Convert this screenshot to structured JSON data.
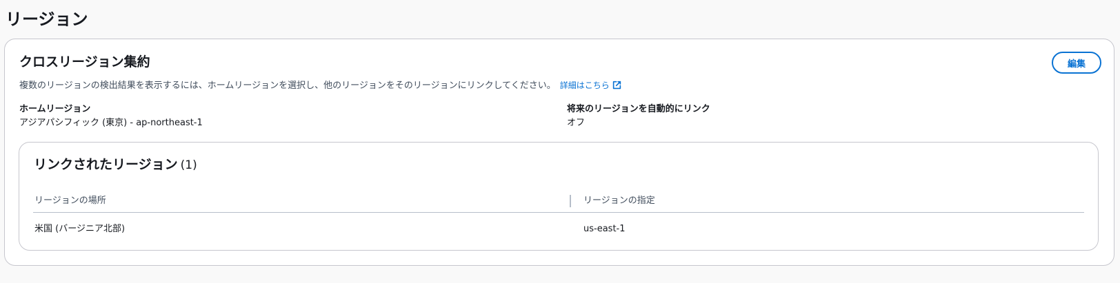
{
  "page": {
    "title": "リージョン"
  },
  "aggregation": {
    "title": "クロスリージョン集約",
    "description": "複数のリージョンの検出結果を表示するには、ホームリージョンを選択し、他のリージョンをそのリージョンにリンクしてください。",
    "learn_more_label": "詳細はこちら",
    "edit_label": "編集",
    "home_region": {
      "label": "ホームリージョン",
      "value": "アジアパシフィック (東京) - ap-northeast-1"
    },
    "auto_link": {
      "label": "将来のリージョンを自動的にリンク",
      "value": "オフ"
    }
  },
  "linked_regions": {
    "title": "リンクされたリージョン",
    "count": "(1)",
    "columns": [
      "リージョンの場所",
      "リージョンの指定"
    ],
    "rows": [
      [
        "米国 (バージニア北部)",
        "us-east-1"
      ]
    ]
  },
  "colors": {
    "accent": "#0972d3",
    "border": "#c6c6cd",
    "background": "#f9f9f9"
  },
  "icons": {
    "external_link": "external-link-icon"
  }
}
